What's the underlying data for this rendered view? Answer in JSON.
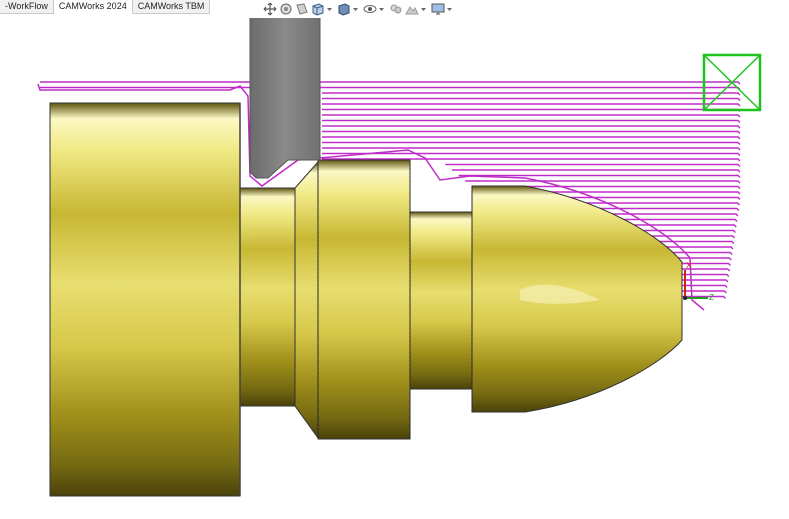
{
  "tabs": [
    {
      "label": "-WorkFlow",
      "active": false
    },
    {
      "label": "CAMWorks 2024",
      "active": true
    },
    {
      "label": "CAMWorks TBM",
      "active": false
    }
  ],
  "toolbar": {
    "icons": [
      "move-arrows-icon",
      "lasso-select-icon",
      "section-view-icon",
      "view-orientation-icon",
      "display-style-icon",
      "hide-show-icon",
      "appearance-icon",
      "scene-icon",
      "monitor-icon"
    ]
  },
  "colors": {
    "toolpath": "#c02cc8",
    "stock_box": "#1ec41e",
    "part_gold_light": "#f4f0a0",
    "part_gold_mid": "#c4b430",
    "part_gold_dark": "#6e6410",
    "tool_holder": "#7c7c7c",
    "axis_x": "#d42020",
    "axis_z": "#1e9e1e"
  },
  "axes": {
    "x_label": "X",
    "z_label": "Z"
  }
}
